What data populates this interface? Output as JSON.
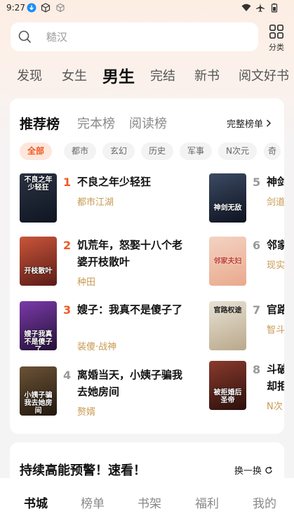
{
  "status": {
    "time": "9:27",
    "icons": [
      "download-icon",
      "cube-icon",
      "cube-outline-icon",
      "wifi-icon",
      "airplane-icon",
      "battery-icon"
    ]
  },
  "search": {
    "placeholder": "糙汉"
  },
  "category": {
    "label": "分类"
  },
  "channel_tabs": [
    {
      "label": "发现",
      "active": false
    },
    {
      "label": "女生",
      "active": false
    },
    {
      "label": "男生",
      "active": true
    },
    {
      "label": "完结",
      "active": false
    },
    {
      "label": "新书",
      "active": false
    },
    {
      "label": "阅文好书",
      "active": false
    }
  ],
  "ranking": {
    "tabs": [
      {
        "label": "推荐榜",
        "active": true
      },
      {
        "label": "完本榜",
        "active": false
      },
      {
        "label": "阅读榜",
        "active": false
      }
    ],
    "full_list": "完整榜单",
    "chips": [
      "全部",
      "都市",
      "玄幻",
      "历史",
      "军事",
      "N次元",
      "奇"
    ],
    "books": [
      {
        "rank": "1",
        "title": "不良之年少轻狂",
        "tag": "都市江湖",
        "cover_text": "不良之年少轻狂",
        "cover_colors": [
          "#2a3344",
          "#0f1520"
        ]
      },
      {
        "rank": "2",
        "title": "饥荒年，怒娶十八个老婆开枝散叶",
        "tag": "种田",
        "cover_text": "开枝散叶",
        "cover_colors": [
          "#c9553a",
          "#5b1b17"
        ]
      },
      {
        "rank": "3",
        "title": "嫂子：我真不是傻子了",
        "tag": "装傻·战神",
        "cover_text": "嫂子我真不是傻子了",
        "cover_colors": [
          "#7a3aa8",
          "#241038"
        ]
      },
      {
        "rank": "4",
        "title": "离婚当天，小姨子骗我去她房间",
        "tag": "赘婿",
        "cover_text": "小姨子骗我去她房间",
        "cover_colors": [
          "#6b5236",
          "#22180f"
        ]
      },
      {
        "rank": "5",
        "title": "神剑",
        "tag": "剑道",
        "cover_text": "神剑无敌",
        "cover_colors": [
          "#3c4a63",
          "#0d1220"
        ]
      },
      {
        "rank": "6",
        "title": "邻家",
        "tag": "现实",
        "cover_text": "邻家夫妇",
        "cover_colors": [
          "#f3d3c3",
          "#e9a98c"
        ]
      },
      {
        "rank": "7",
        "title": "官路",
        "tag": "智斗",
        "cover_text": "官路权途",
        "cover_colors": [
          "#e8e2d6",
          "#b9a889"
        ]
      },
      {
        "rank": "8",
        "title": "斗破却拒",
        "tag": "N次",
        "cover_text": "被拒婚后圣帝",
        "cover_colors": [
          "#8a3a2c",
          "#2a0f0c"
        ]
      }
    ]
  },
  "section2": {
    "title": "持续高能预警！速看！",
    "refresh": "换一换"
  },
  "bottom_nav": [
    {
      "label": "书城",
      "active": true
    },
    {
      "label": "榜单",
      "active": false
    },
    {
      "label": "书架",
      "active": false
    },
    {
      "label": "福利",
      "active": false
    },
    {
      "label": "我的",
      "active": false
    }
  ]
}
